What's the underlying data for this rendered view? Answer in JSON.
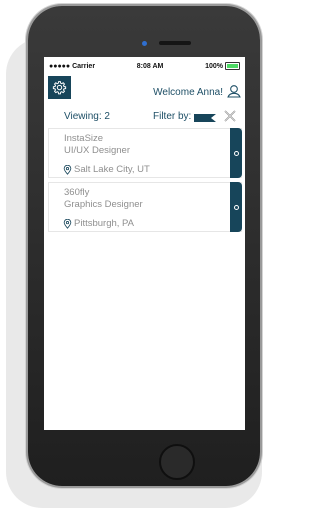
{
  "status_bar": {
    "carrier": "●●●●● Carrier",
    "time": "8:08 AM",
    "battery": "100%",
    "battery_level": 1.0
  },
  "header": {
    "welcome": "Welcome Anna!",
    "settings_icon": "gear-icon",
    "profile_icon": "user-icon"
  },
  "filter_bar": {
    "viewing": "Viewing: 2",
    "filter_label": "Filter by:",
    "filter_icon": "flag-icon",
    "clear_icon": "close-icon"
  },
  "jobs": [
    {
      "company": "InstaSize",
      "role": "UI/UX Designer",
      "location": "Salt Lake City, UT"
    },
    {
      "company": "360fly",
      "role": "Graphics Designer",
      "location": "Pittsburgh, PA"
    }
  ],
  "colors": {
    "accent": "#17455a",
    "text_accent": "#1e4f66",
    "muted": "#8f8f8f"
  }
}
